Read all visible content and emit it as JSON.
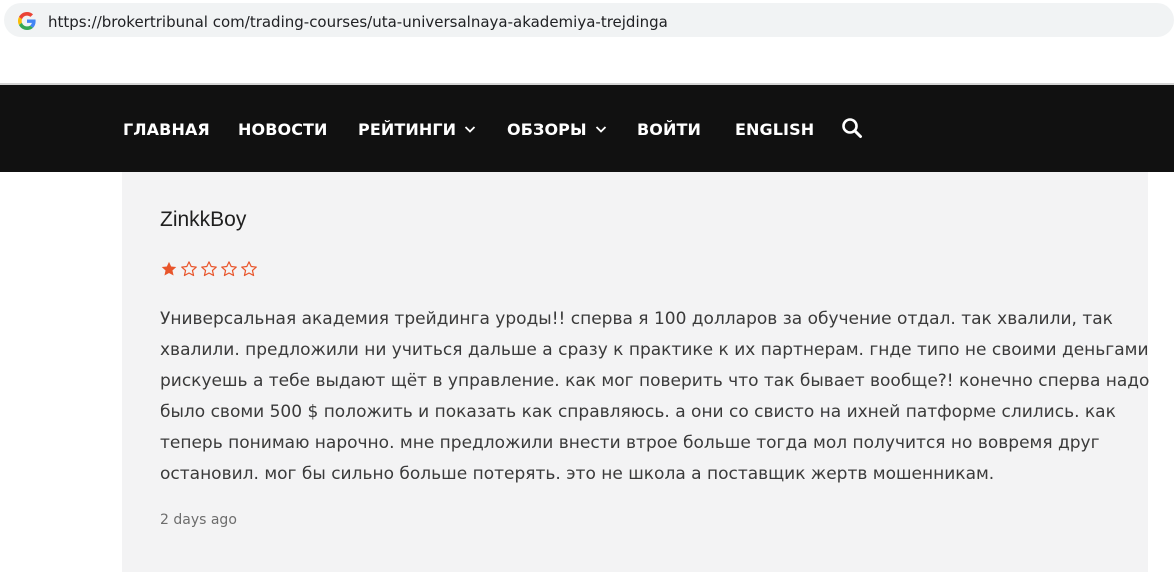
{
  "browser": {
    "url": "https://brokertribunal com/trading-courses/uta-universalnaya-akademiya-trejdinga",
    "site_icon": "google-g-icon"
  },
  "nav": {
    "items": [
      {
        "label": "ГЛАВНАЯ",
        "has_dropdown": false
      },
      {
        "label": "НОВОСТИ",
        "has_dropdown": false
      },
      {
        "label": "РЕЙТИНГИ",
        "has_dropdown": true
      },
      {
        "label": "ОБЗОРЫ",
        "has_dropdown": true
      },
      {
        "label": "ВОЙТИ",
        "has_dropdown": false
      },
      {
        "label": "ENGLISH",
        "has_dropdown": false
      }
    ],
    "search_icon": "search-icon"
  },
  "review": {
    "author": "ZinkkBoy",
    "rating": 1,
    "rating_max": 5,
    "text_lines": [
      "Универсальная академия трейдинга уроды!! сперва я 100 долларов за обучение отдал. так хвалили, так",
      "хвалили. предложили ни учиться дальше а сразу к практике к их партнерам. гнде типо не своими деньгами",
      "рискуешь а тебе выдают щёт в управление. как мог поверить что так бывает вообще?! конечно сперва надо",
      "было своми 500 $ положить и показать как справляюсь. а они со свисто на ихней патформе слились. как",
      "теперь понимаю нарочно. мне предложили внести втрое больше тогда мол получится но вовремя друг",
      "остановил. мог бы сильно больше потерять. это не школа а поставщик жертв мошенникам."
    ],
    "time": "2 days ago"
  },
  "colors": {
    "navbar_bg": "#111111",
    "card_bg": "#f3f3f4",
    "star": "#e8552b"
  }
}
